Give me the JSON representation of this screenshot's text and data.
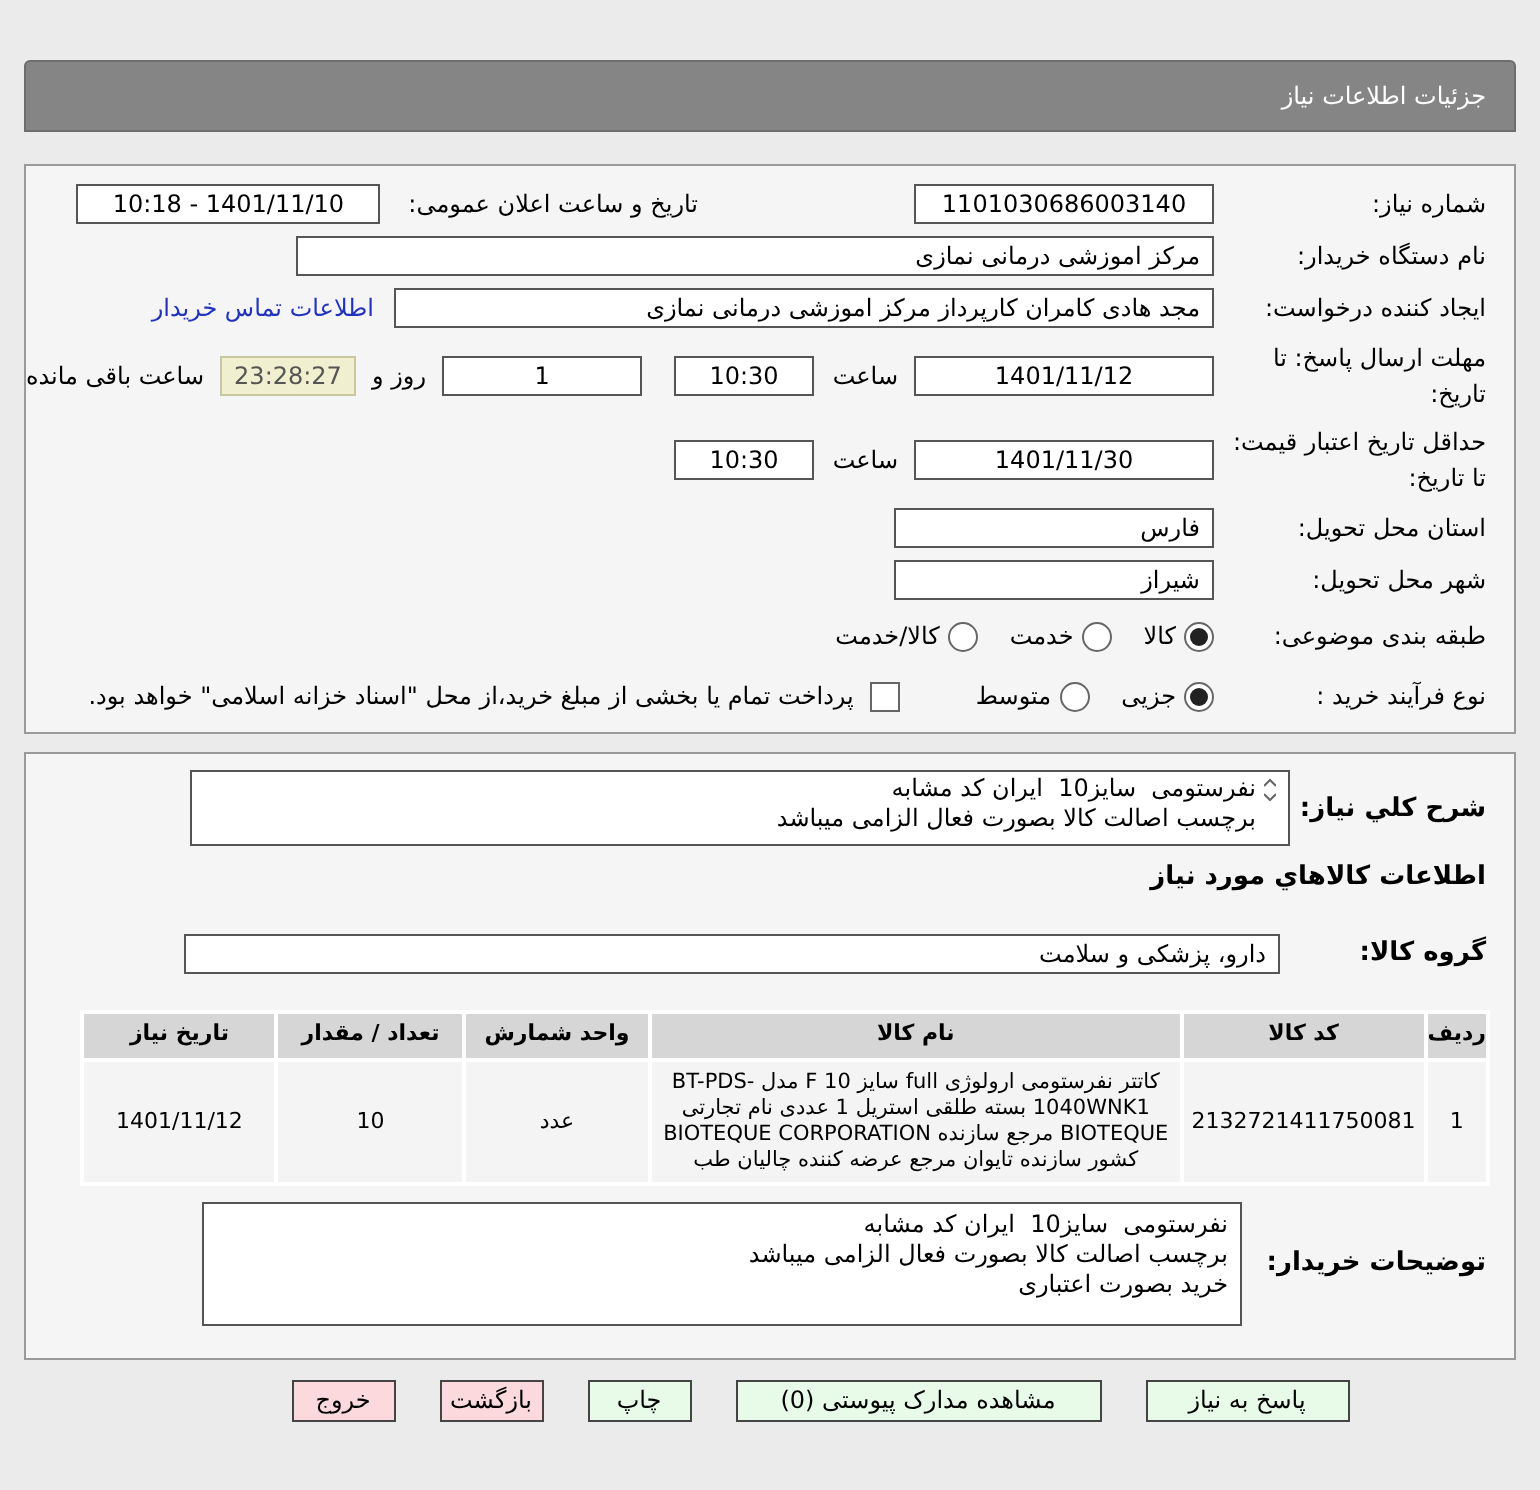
{
  "header": {
    "title": "جزئیات اطلاعات نیاز"
  },
  "need_number": {
    "label": "شماره نیاز:",
    "value": "1101030686003140"
  },
  "announce": {
    "label": "تاریخ و ساعت اعلان عمومی:",
    "value": "1401/11/10 - 10:18"
  },
  "buyer_org": {
    "label": "نام دستگاه خریدار:",
    "value": "مرکز اموزشی درمانی نمازی"
  },
  "creator": {
    "label": "ایجاد کننده درخواست:",
    "value": "مجد هادی کامران کارپرداز مرکز اموزشی درمانی نمازی",
    "link": "اطلاعات تماس خریدار"
  },
  "deadline": {
    "label": "مهلت ارسال پاسخ: تا تاریخ:",
    "date": "1401/11/12",
    "time_label": "ساعت",
    "time": "10:30",
    "days": "1",
    "days_label": "روز و",
    "remaining": "23:28:27",
    "remaining_label": "ساعت باقی مانده"
  },
  "validity": {
    "label": "حداقل تاریخ اعتبار قیمت: تا تاریخ:",
    "date": "1401/11/30",
    "time_label": "ساعت",
    "time": "10:30"
  },
  "province": {
    "label": "استان محل تحویل:",
    "value": "فارس"
  },
  "city": {
    "label": "شهر محل تحویل:",
    "value": "شیراز"
  },
  "category": {
    "label": "طبقه بندی موضوعی:",
    "options": [
      {
        "label": "کالا",
        "selected": true
      },
      {
        "label": "خدمت",
        "selected": false
      },
      {
        "label": "کالا/خدمت",
        "selected": false
      }
    ]
  },
  "process": {
    "label": "نوع فرآیند خرید :",
    "options": [
      {
        "label": "جزیی",
        "selected": true
      },
      {
        "label": "متوسط",
        "selected": false
      }
    ],
    "treasury": {
      "label": "پرداخت تمام یا بخشی از مبلغ خرید،از محل \"اسناد خزانه اسلامی\" خواهد بود.",
      "checked": false
    }
  },
  "description": {
    "label": "شرح کلي نياز:",
    "lines": [
      "نفرستومی  سایز10  ایران کد مشابه",
      "برچسب اصالت کالا بصورت فعال الزامی میباشد"
    ]
  },
  "goods_heading": "اطلاعات کالاهاي مورد نياز",
  "goods_group": {
    "label": "گروه کالا:",
    "value": "دارو، پزشکی و سلامت"
  },
  "table": {
    "columns": [
      "ردیف",
      "کد کالا",
      "نام کالا",
      "واحد شمارش",
      "تعداد / مقدار",
      "تاریخ نیاز"
    ],
    "rows": [
      [
        "1",
        "2132721411750081",
        "کاتتر نفرستومی ارولوژی full سایز 10 F مدل BT-PDS-1040WNK1 بسته طلقی استریل 1 عددی نام تجارتی BIOTEQUE مرجع سازنده BIOTEQUE CORPORATION کشور سازنده تایوان مرجع عرضه کننده چالیان طب",
        "عدد",
        "10",
        "1401/11/12"
      ]
    ]
  },
  "buyer_notes": {
    "label": "توضیحات خریدار:",
    "lines": [
      "نفرستومی  سایز10  ایران کد مشابه",
      "برچسب اصالت کالا بصورت فعال الزامی میباشد",
      "خرید بصورت اعتباری"
    ]
  },
  "buttons": [
    {
      "label": "پاسخ به نیاز",
      "kind": "green"
    },
    {
      "label": "مشاهده مدارک پیوستی (0)",
      "kind": "green"
    },
    {
      "label": "چاپ",
      "kind": "green"
    },
    {
      "label": "بازگشت",
      "kind": "red"
    },
    {
      "label": "خروج",
      "kind": "red"
    }
  ]
}
